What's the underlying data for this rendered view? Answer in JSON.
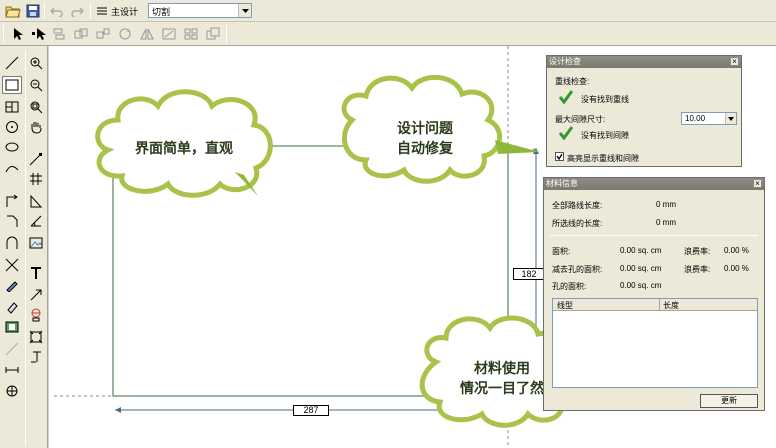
{
  "toolbar": {
    "design_label": "主设计",
    "combo_value": "切割"
  },
  "canvas": {
    "dim_horizontal": "287",
    "dim_vertical": "182"
  },
  "callouts": {
    "interface": "界面简单，直观",
    "auto_fix_line1": "设计问题",
    "auto_fix_line2": "自动修复",
    "material_line1": "材料使用",
    "material_line2": "情况一目了然"
  },
  "design_check": {
    "title": "设计检查",
    "overlap_label": "重线检查:",
    "overlap_result": "没有找到重线",
    "max_gap_label": "最大间隙尺寸:",
    "max_gap_value": "10.00",
    "gap_result": "没有找到间隙",
    "highlight_label": "高亮显示重线和间隙",
    "highlight_checked": true
  },
  "material_info": {
    "title": "材料信息",
    "total_path_label": "全部路线长度:",
    "total_path_value": "0 mm",
    "selected_path_label": "所选线的长度:",
    "selected_path_value": "0 mm",
    "area_label": "面积:",
    "area_value": "0.00 sq. cm",
    "waste1_label": "浪费率:",
    "waste1_value": "0.00 %",
    "area_minus_label": "减去孔的面积:",
    "area_minus_value": "0.00 sq. cm",
    "waste2_label": "浪费率:",
    "waste2_value": "0.00 %",
    "hole_area_label": "孔的面积:",
    "hole_area_value": "0.00 sq. cm",
    "table_headers": [
      "线型",
      "长度"
    ],
    "update_button": "更新"
  },
  "colors": {
    "accent_green": "#8fb83a",
    "check_green": "#2e9a2e",
    "shape_line": "#3b6b3b"
  }
}
